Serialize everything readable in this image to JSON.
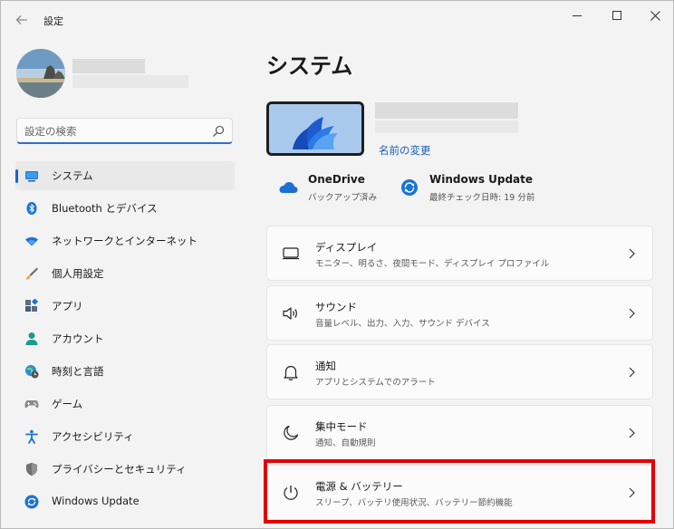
{
  "titlebar": {
    "app_title": "設定"
  },
  "search": {
    "placeholder": "設定の検索"
  },
  "sidebar": {
    "items": [
      {
        "label": "システム",
        "icon": "monitor-icon",
        "active": true
      },
      {
        "label": "Bluetooth とデバイス",
        "icon": "bluetooth-icon"
      },
      {
        "label": "ネットワークとインターネット",
        "icon": "wifi-icon"
      },
      {
        "label": "個人用設定",
        "icon": "brush-icon"
      },
      {
        "label": "アプリ",
        "icon": "apps-icon"
      },
      {
        "label": "アカウント",
        "icon": "person-icon"
      },
      {
        "label": "時刻と言語",
        "icon": "globe-clock-icon"
      },
      {
        "label": "ゲーム",
        "icon": "gamepad-icon"
      },
      {
        "label": "アクセシビリティ",
        "icon": "accessibility-icon"
      },
      {
        "label": "プライバシーとセキュリティ",
        "icon": "shield-icon"
      },
      {
        "label": "Windows Update",
        "icon": "update-icon"
      }
    ]
  },
  "main": {
    "title": "システム",
    "rename_link": "名前の変更",
    "services": [
      {
        "title": "OneDrive",
        "subtitle": "バックアップ済み",
        "icon": "cloud-icon"
      },
      {
        "title": "Windows Update",
        "subtitle": "最終チェック日時: 19 分前",
        "icon": "update-icon"
      }
    ],
    "cards": [
      {
        "title": "ディスプレイ",
        "subtitle": "モニター、明るさ、夜間モード、ディスプレイ プロファイル",
        "icon": "display-icon"
      },
      {
        "title": "サウンド",
        "subtitle": "音量レベル、出力、入力、サウンド デバイス",
        "icon": "speaker-icon"
      },
      {
        "title": "通知",
        "subtitle": "アプリとシステムでのアラート",
        "icon": "bell-icon"
      },
      {
        "title": "集中モード",
        "subtitle": "通知、自動規則",
        "icon": "moon-icon"
      },
      {
        "title": "電源 & バッテリー",
        "subtitle": "スリープ、バッテリ使用状況、バッテリー節約機能",
        "icon": "power-icon"
      }
    ]
  },
  "colors": {
    "accent": "#1a63c5",
    "highlight": "#e50000",
    "link": "#1a5fb4"
  }
}
